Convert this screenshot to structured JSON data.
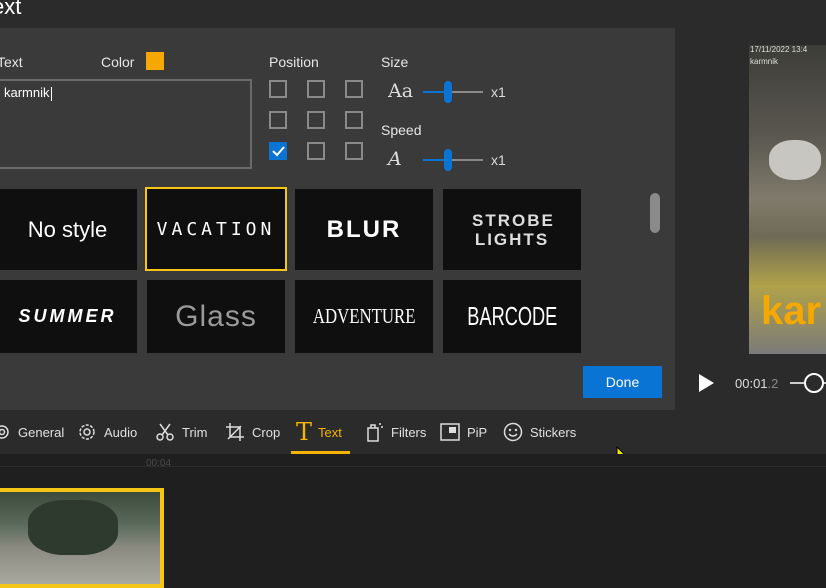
{
  "window": {
    "title": "ext"
  },
  "text_panel": {
    "text_label": "Text",
    "color_label": "Color",
    "accent_color": "#f5a800",
    "text_value": "karmnik",
    "position_label": "Position",
    "position_selected": "bottom-left",
    "size_label": "Size",
    "size_value": "x1",
    "speed_label": "Speed",
    "speed_value": "x1",
    "size_icon_glyph": "Aa",
    "speed_icon_glyph": "A"
  },
  "styles": [
    {
      "label": "No style",
      "selected": false
    },
    {
      "label": "VACATION",
      "selected": true
    },
    {
      "label": "BLUR",
      "selected": false
    },
    {
      "label": "STROBE LIGHTS",
      "selected": false
    },
    {
      "label": "SUMMER",
      "selected": false
    },
    {
      "label": "Glass",
      "selected": false
    },
    {
      "label": "ADVENTURE",
      "selected": false
    },
    {
      "label": "BARCODE",
      "selected": false
    }
  ],
  "done_label": "Done",
  "preview": {
    "timestamp": "17/11/2022 13:4",
    "camera_label": "karmnik",
    "overlay_text": "kar",
    "time_current": "00:01",
    "time_fraction": ".2"
  },
  "toolbar": {
    "items": [
      {
        "label": "General",
        "icon": "gear-icon"
      },
      {
        "label": "Audio",
        "icon": "audio-gear-icon"
      },
      {
        "label": "Trim",
        "icon": "scissors-icon"
      },
      {
        "label": "Crop",
        "icon": "crop-icon"
      },
      {
        "label": "Text",
        "icon": "text-icon",
        "active": true
      },
      {
        "label": "Filters",
        "icon": "filters-icon"
      },
      {
        "label": "PiP",
        "icon": "pip-icon"
      },
      {
        "label": "Stickers",
        "icon": "smiley-icon"
      }
    ]
  },
  "timeline": {
    "ruler_mark": "00:04"
  },
  "colors": {
    "accent": "#f5b400",
    "primary": "#0a74d4",
    "panel": "#3a3a3a"
  }
}
